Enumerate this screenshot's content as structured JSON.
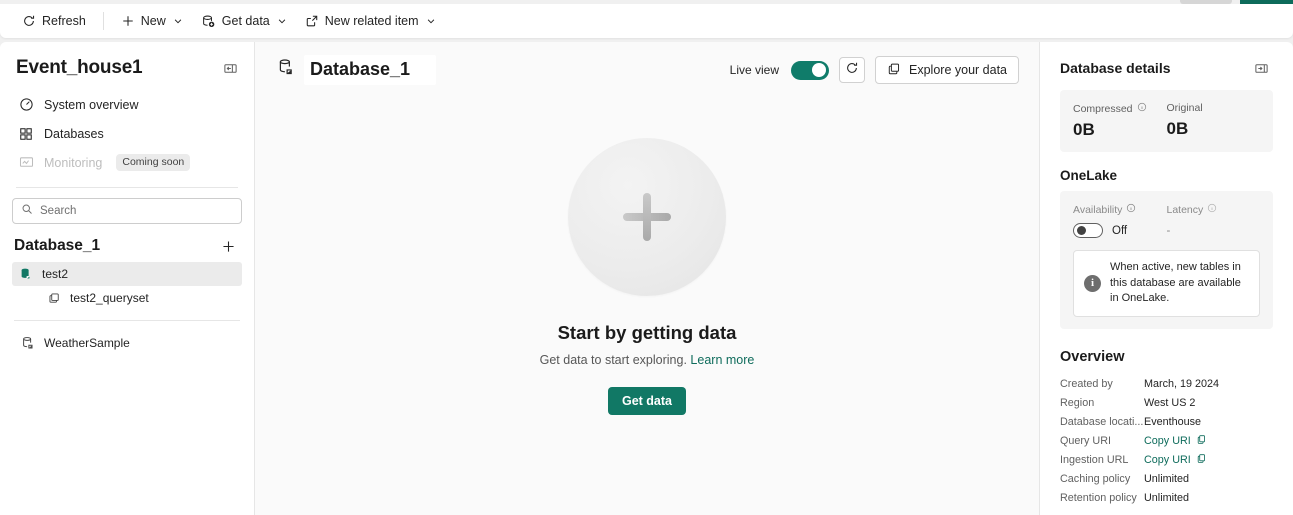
{
  "commandbar": {
    "items": [
      {
        "label": "Refresh",
        "icon": "refresh-icon",
        "caret": false
      },
      {
        "label": "New",
        "icon": "plus-icon",
        "caret": true
      },
      {
        "label": "Get data",
        "icon": "get-data-icon",
        "caret": true
      },
      {
        "label": "New related item",
        "icon": "open-external-icon",
        "caret": true
      }
    ]
  },
  "sidebar": {
    "title": "Event_house1",
    "collapse_icon": "collapse-panel-icon",
    "nav": [
      {
        "label": "System overview",
        "icon": "gauge-icon",
        "disabled": false,
        "badge": ""
      },
      {
        "label": "Databases",
        "icon": "grid-squares-icon",
        "disabled": false,
        "badge": ""
      },
      {
        "label": "Monitoring",
        "icon": "monitor-chart-icon",
        "disabled": true,
        "badge": "Coming soon"
      }
    ],
    "search": {
      "placeholder": "Search",
      "value": "",
      "icon": "search-icon"
    },
    "database_section": {
      "title": "Database_1",
      "add_icon": "plus-icon"
    },
    "tree": [
      {
        "label": "test2",
        "icon": "database-filled-icon",
        "selected": true,
        "level": 0
      },
      {
        "label": "test2_queryset",
        "icon": "queryset-icon",
        "selected": false,
        "level": 1
      }
    ],
    "tree_secondary": [
      {
        "label": "WeatherSample",
        "icon": "database-outline-icon",
        "selected": false,
        "level": 0
      }
    ]
  },
  "main": {
    "database_name": "Database_1",
    "database_icon": "database-outline-icon",
    "live_view_label": "Live view",
    "live_view_on": true,
    "refresh_icon": "refresh-icon",
    "explore_button": {
      "label": "Explore your data",
      "icon": "explore-data-icon"
    },
    "empty_state": {
      "plus_icon": "plus-circle-icon",
      "title": "Start by getting data",
      "subtitle": "Get data to start exploring.",
      "link": "Learn more",
      "button": "Get data"
    }
  },
  "details": {
    "title": "Database details",
    "collapse_icon": "collapse-panel-right-icon",
    "stats": [
      {
        "label": "Compressed",
        "info": true,
        "value": "0B"
      },
      {
        "label": "Original",
        "info": false,
        "value": "0B"
      }
    ],
    "onelake": {
      "title": "OneLake",
      "availability_label": "Availability",
      "availability_state": "Off",
      "availability_on": false,
      "latency_label": "Latency",
      "latency_value": "-",
      "info_icon": "info-circle-icon",
      "note": "When active, new tables in this database are available in OneLake."
    },
    "overview": {
      "title": "Overview",
      "rows": [
        {
          "key": "Created by",
          "value": "March, 19 2024",
          "link": false,
          "copy": false
        },
        {
          "key": "Region",
          "value": "West US 2",
          "link": false,
          "copy": false
        },
        {
          "key": "Database locati...",
          "value": "Eventhouse",
          "link": false,
          "copy": false
        },
        {
          "key": "Query URI",
          "value": "Copy URI",
          "link": true,
          "copy": true
        },
        {
          "key": "Ingestion URL",
          "value": "Copy URI",
          "link": true,
          "copy": true
        },
        {
          "key": "Caching policy",
          "value": "Unlimited",
          "link": false,
          "copy": false
        },
        {
          "key": "Retention policy",
          "value": "Unlimited",
          "link": false,
          "copy": false
        }
      ]
    }
  },
  "colors": {
    "accent": "#117865",
    "link": "#0f6c5c",
    "toggle_on": "#107c6a"
  }
}
